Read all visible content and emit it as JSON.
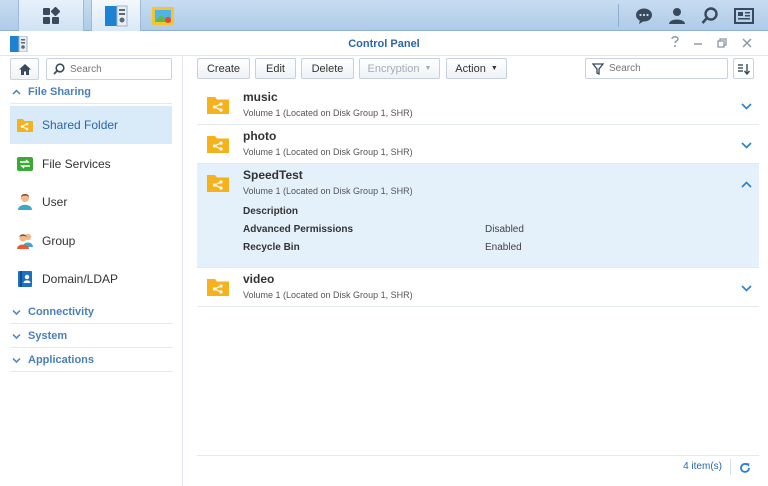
{
  "window": {
    "title": "Control Panel"
  },
  "sidebar": {
    "search_placeholder": "Search",
    "categories": {
      "file_sharing": "File Sharing",
      "connectivity": "Connectivity",
      "system": "System",
      "applications": "Applications"
    },
    "items": [
      {
        "label": "Shared Folder",
        "icon": "shared-folder-icon",
        "active": true
      },
      {
        "label": "File Services",
        "icon": "file-services-icon"
      },
      {
        "label": "User",
        "icon": "user-icon"
      },
      {
        "label": "Group",
        "icon": "group-icon"
      },
      {
        "label": "Domain/LDAP",
        "icon": "domain-ldap-icon"
      }
    ]
  },
  "toolbar": {
    "create": "Create",
    "edit": "Edit",
    "delete": "Delete",
    "encryption": "Encryption",
    "action": "Action",
    "search_placeholder": "Search"
  },
  "folders": [
    {
      "name": "music",
      "location": "Volume 1 (Located on Disk Group 1, SHR)"
    },
    {
      "name": "photo",
      "location": "Volume 1 (Located on Disk Group 1, SHR)"
    },
    {
      "name": "SpeedTest",
      "location": "Volume 1 (Located on Disk Group 1, SHR)",
      "details": {
        "description_label": "Description",
        "advanced_permissions_label": "Advanced Permissions",
        "advanced_permissions_value": "Disabled",
        "recycle_bin_label": "Recycle Bin",
        "recycle_bin_value": "Enabled"
      }
    },
    {
      "name": "video",
      "location": "Volume 1 (Located on Disk Group 1, SHR)"
    }
  ],
  "footer": {
    "count": "4 item(s)"
  },
  "colors": {
    "accent": "#2a67a8",
    "folder": "#f5b21c",
    "selected": "#d9eaf8"
  }
}
